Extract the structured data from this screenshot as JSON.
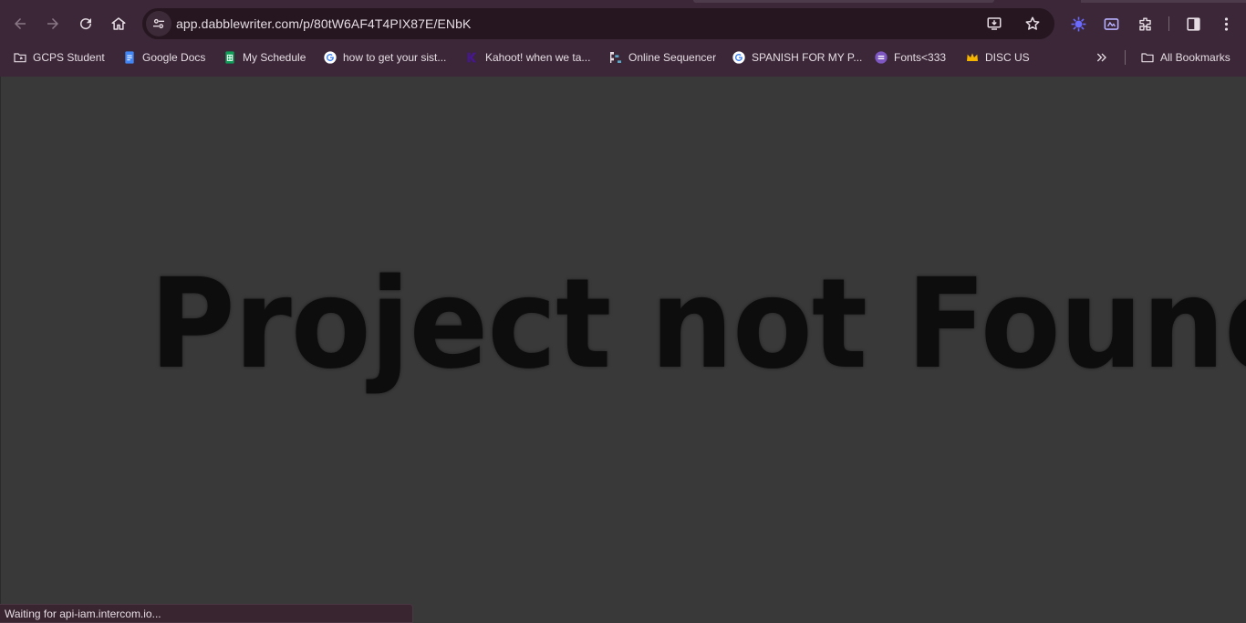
{
  "browser": {
    "url": "app.dabblewriter.com/p/80tW6AF4T4PIX87E/ENbK",
    "bookmarks": [
      {
        "label": "GCPS Student",
        "icon": "folder-shortcut-icon"
      },
      {
        "label": "Google Docs",
        "icon": "google-docs-icon"
      },
      {
        "label": "My Schedule",
        "icon": "google-sheets-icon"
      },
      {
        "label": "how to get your sist...",
        "icon": "google-icon"
      },
      {
        "label": "Kahoot! when we ta...",
        "icon": "kahoot-icon"
      },
      {
        "label": "Online Sequencer",
        "icon": "sequencer-icon"
      },
      {
        "label": "SPANISH FOR MY P...",
        "icon": "google-icon"
      },
      {
        "label": "Fonts<333",
        "icon": "fonts-icon"
      },
      {
        "label": "DISC US",
        "icon": "crown-icon"
      }
    ],
    "all_bookmarks_label": "All Bookmarks",
    "status_text": "Waiting for api-iam.intercom.io..."
  },
  "page": {
    "heading": "Project not Found"
  },
  "colors": {
    "frame": "#3b2738",
    "omnibox": "#25161f",
    "content_bg": "#393939",
    "heading": "#0d0d0d",
    "extension_accent": "#6b6bff"
  }
}
